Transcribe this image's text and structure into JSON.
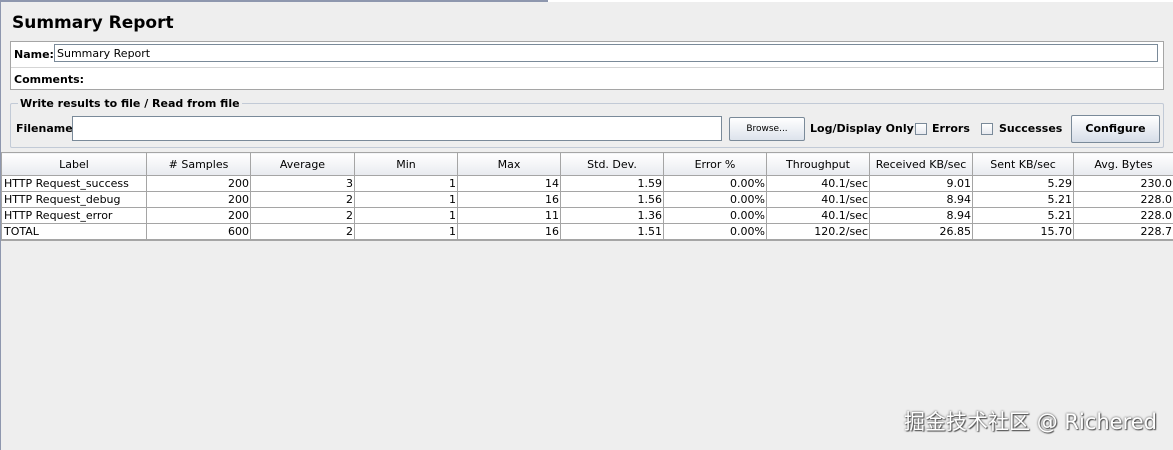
{
  "panel": {
    "title": "Summary Report"
  },
  "name_section": {
    "name_label": "Name:",
    "name_value": "Summary Report",
    "comments_label": "Comments:"
  },
  "file_section": {
    "group_title": "Write results to file / Read from file",
    "filename_label": "Filename",
    "filename_value": "",
    "browse_label": "Browse...",
    "log_display_label": "Log/Display Only:",
    "errors_label": "Errors",
    "successes_label": "Successes",
    "configure_label": "Configure"
  },
  "table": {
    "columns": [
      "Label",
      "# Samples",
      "Average",
      "Min",
      "Max",
      "Std. Dev.",
      "Error %",
      "Throughput",
      "Received KB/sec",
      "Sent KB/sec",
      "Avg. Bytes"
    ],
    "rows": [
      [
        "HTTP Request_success",
        "200",
        "3",
        "1",
        "14",
        "1.59",
        "0.00%",
        "40.1/sec",
        "9.01",
        "5.29",
        "230.0"
      ],
      [
        "HTTP Request_debug",
        "200",
        "2",
        "1",
        "16",
        "1.56",
        "0.00%",
        "40.1/sec",
        "8.94",
        "5.21",
        "228.0"
      ],
      [
        "HTTP Request_error",
        "200",
        "2",
        "1",
        "11",
        "1.36",
        "0.00%",
        "40.1/sec",
        "8.94",
        "5.21",
        "228.0"
      ],
      [
        "TOTAL",
        "600",
        "2",
        "1",
        "16",
        "1.51",
        "0.00%",
        "120.2/sec",
        "26.85",
        "15.70",
        "228.7"
      ]
    ]
  },
  "watermark": "掘金技术社区 @ Richered",
  "colors": {
    "background": "#eeeeee",
    "border": "#a5a5a5",
    "frame_accent": "#8e97ae"
  }
}
